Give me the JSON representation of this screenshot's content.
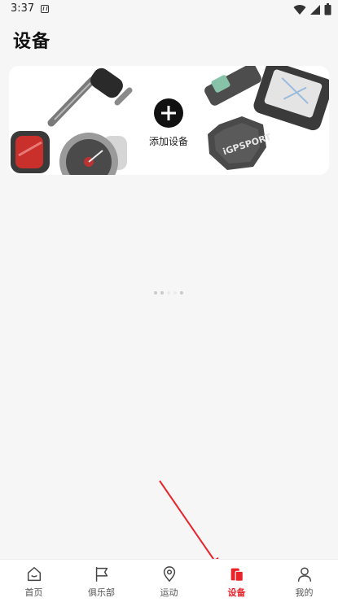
{
  "status_bar": {
    "time": "3:37"
  },
  "page": {
    "title": "设备"
  },
  "device_card": {
    "add_label": "添加设备",
    "watermark_text": "iGPSPORT"
  },
  "tabs": [
    {
      "label": "首页",
      "icon": "home-icon",
      "active": false
    },
    {
      "label": "俱乐部",
      "icon": "flag-icon",
      "active": false
    },
    {
      "label": "运动",
      "icon": "location-pin-icon",
      "active": false
    },
    {
      "label": "设备",
      "icon": "device-icon",
      "active": true
    },
    {
      "label": "我的",
      "icon": "person-icon",
      "active": false
    }
  ],
  "colors": {
    "accent": "#e8242a",
    "background": "#f6f6f6"
  }
}
